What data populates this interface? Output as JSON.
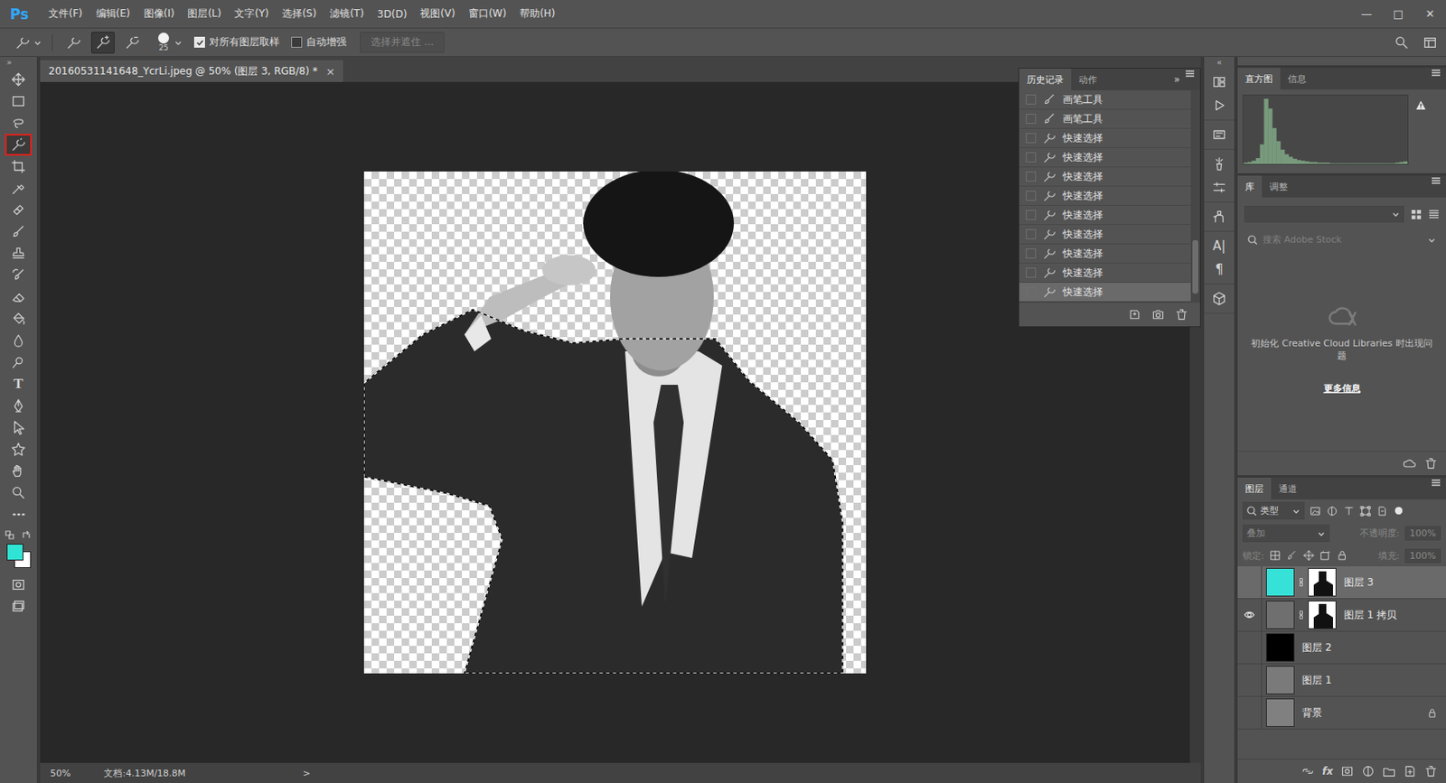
{
  "app": {
    "logo": "Ps"
  },
  "menu": [
    "文件(F)",
    "编辑(E)",
    "图像(I)",
    "图层(L)",
    "文字(Y)",
    "选择(S)",
    "滤镜(T)",
    "3D(D)",
    "视图(V)",
    "窗口(W)",
    "帮助(H)"
  ],
  "window_controls": [
    "—",
    "□",
    "✕"
  ],
  "options_bar": {
    "brush_size": "25",
    "modes": [
      {
        "selected": false
      },
      {
        "selected": true
      },
      {
        "selected": false
      }
    ],
    "checkboxes": [
      {
        "label": "对所有图层取样",
        "checked": true
      },
      {
        "label": "自动增强",
        "checked": false
      }
    ],
    "button": {
      "label": "选择并遮住 ...",
      "disabled": true
    }
  },
  "toolbar": {
    "collapse": "»",
    "tools": [
      {
        "selected": false
      },
      {
        "selected": false
      },
      {
        "selected": false
      },
      {
        "selected": true
      },
      {
        "selected": false
      },
      {
        "selected": false
      },
      {
        "selected": false
      },
      {
        "selected": false
      },
      {
        "selected": false
      },
      {
        "selected": false
      },
      {
        "selected": false
      },
      {
        "selected": false
      },
      {
        "selected": false
      },
      {
        "selected": false
      },
      {
        "glyph": "T",
        "selected": false
      },
      {
        "selected": false
      },
      {
        "selected": false
      },
      {
        "selected": false
      },
      {
        "selected": false
      },
      {
        "selected": false
      },
      {
        "selected": false
      }
    ],
    "foreground": "#2fe3d5",
    "background": "#ffffff"
  },
  "document": {
    "tab": {
      "label": "20160531141648_YcrLi.jpeg @ 50% (图层 3, RGB/8) *",
      "close": "×",
      "selected": true
    }
  },
  "status_bar": {
    "zoom": "50%",
    "doc_size": "文档:4.13M/18.8M",
    "arrow": ">"
  },
  "history_panel": {
    "tabs": [
      {
        "label": "历史记录",
        "selected": true
      },
      {
        "label": "动作",
        "selected": false
      }
    ],
    "expand": "»",
    "items": [
      {
        "label": "画笔工具",
        "kind": "brush",
        "selected": false
      },
      {
        "label": "画笔工具",
        "kind": "brush",
        "selected": false
      },
      {
        "label": "快速选择",
        "kind": "quick",
        "selected": false
      },
      {
        "label": "快速选择",
        "kind": "quick",
        "selected": false
      },
      {
        "label": "快速选择",
        "kind": "quick",
        "selected": false
      },
      {
        "label": "快速选择",
        "kind": "quick",
        "selected": false
      },
      {
        "label": "快速选择",
        "kind": "quick",
        "selected": false
      },
      {
        "label": "快速选择",
        "kind": "quick",
        "selected": false
      },
      {
        "label": "快速选择",
        "kind": "quick",
        "selected": false
      },
      {
        "label": "快速选择",
        "kind": "quick",
        "selected": false
      },
      {
        "label": "快速选择",
        "kind": "quick",
        "selected": true
      }
    ]
  },
  "strip": {
    "collapse": "«",
    "glyphs": [
      "A|",
      "¶"
    ]
  },
  "histogram_panel": {
    "tabs": [
      {
        "label": "直方图",
        "selected": true
      },
      {
        "label": "信息",
        "selected": false
      }
    ],
    "values": [
      2,
      3,
      5,
      9,
      30,
      100,
      85,
      55,
      35,
      22,
      15,
      11,
      8,
      6,
      5,
      4,
      3,
      3,
      2,
      2,
      2,
      1,
      1,
      1,
      1,
      1,
      1,
      1,
      1,
      1,
      1,
      1,
      1,
      1,
      1,
      1,
      1,
      2,
      3,
      4
    ]
  },
  "library_panel": {
    "tabs": [
      {
        "label": "库",
        "selected": true
      },
      {
        "label": "调整",
        "selected": false
      }
    ],
    "search_placeholder": "搜索 Adobe Stock",
    "message": "初始化 Creative Cloud Libraries 时出现问题",
    "link": "更多信息"
  },
  "layers_panel": {
    "tabs": [
      {
        "label": "图层",
        "selected": true
      },
      {
        "label": "通道",
        "selected": false
      }
    ],
    "filter": "类型",
    "blend_mode": "叠加",
    "opacity_label": "不透明度:",
    "opacity": "100%",
    "lock_label": "锁定:",
    "fill_label": "填充:",
    "fill": "100%",
    "controls_disabled": true,
    "footer_glyph": "fx",
    "layers": [
      {
        "name": "图层 3",
        "visible": false,
        "selected": true,
        "mask": true,
        "locked": false,
        "color": "#36e2d8"
      },
      {
        "name": "图层 1 拷贝",
        "visible": true,
        "selected": false,
        "mask": true,
        "locked": false,
        "color": "#6f6f6f"
      },
      {
        "name": "图层 2",
        "visible": false,
        "selected": false,
        "mask": false,
        "locked": false,
        "color": "#000000"
      },
      {
        "name": "图层 1",
        "visible": false,
        "selected": false,
        "mask": false,
        "locked": false,
        "color": "#7a7a7a"
      },
      {
        "name": "背景",
        "visible": false,
        "selected": false,
        "mask": false,
        "locked": true,
        "color": "#808080"
      }
    ]
  }
}
